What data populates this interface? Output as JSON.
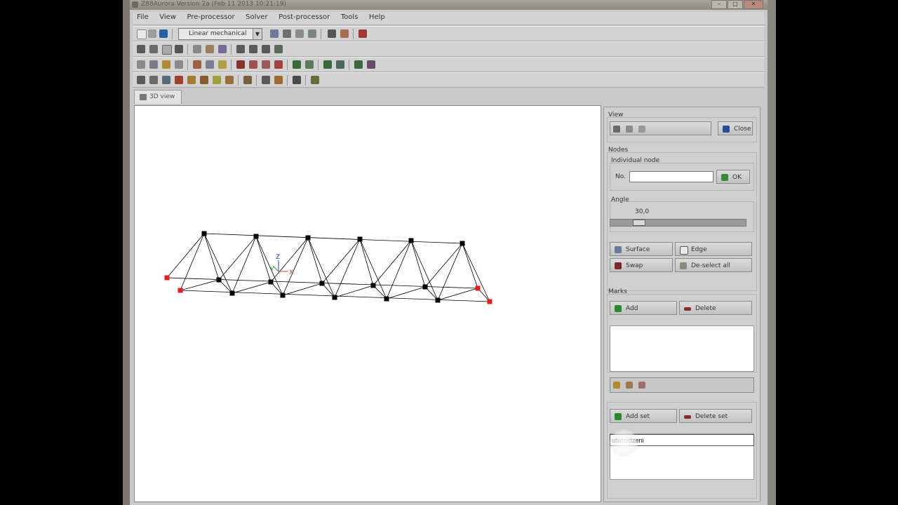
{
  "window": {
    "title": "Z88Aurora Version 2a (Feb 11 2013 10:21:19)"
  },
  "menu": [
    "File",
    "View",
    "Pre-processor",
    "Solver",
    "Post-processor",
    "Tools",
    "Help"
  ],
  "toolbar": {
    "analysis_type": "Linear mechanical"
  },
  "tabs": [
    "3D view"
  ],
  "panel": {
    "view_group": "View",
    "close_label": "Close",
    "nodes_group": "Nodes",
    "individual_node_group": "Individual node",
    "no_label": "No.",
    "no_value": "",
    "ok_label": "OK",
    "angle_group": "Angle",
    "angle_value": "30,0",
    "angle_fraction": 0.18,
    "surface_label": "Surface",
    "edge_label": "Edge",
    "swap_label": "Swap",
    "deselect_label": "De-select all",
    "marks_group": "Marks",
    "add_label": "Add",
    "delete_label": "Delete",
    "add_set_label": "Add set",
    "delete_set_label": "Delete set",
    "set_name_value": "utwierdzeni"
  },
  "axes": {
    "z": "Z",
    "y": "Y",
    "x": "X"
  },
  "colors": {
    "selected_node": "#e02020",
    "node": "#000000",
    "background": "#ffffff",
    "add_green": "#2a8a2a",
    "delete_red": "#8a2a2a"
  }
}
